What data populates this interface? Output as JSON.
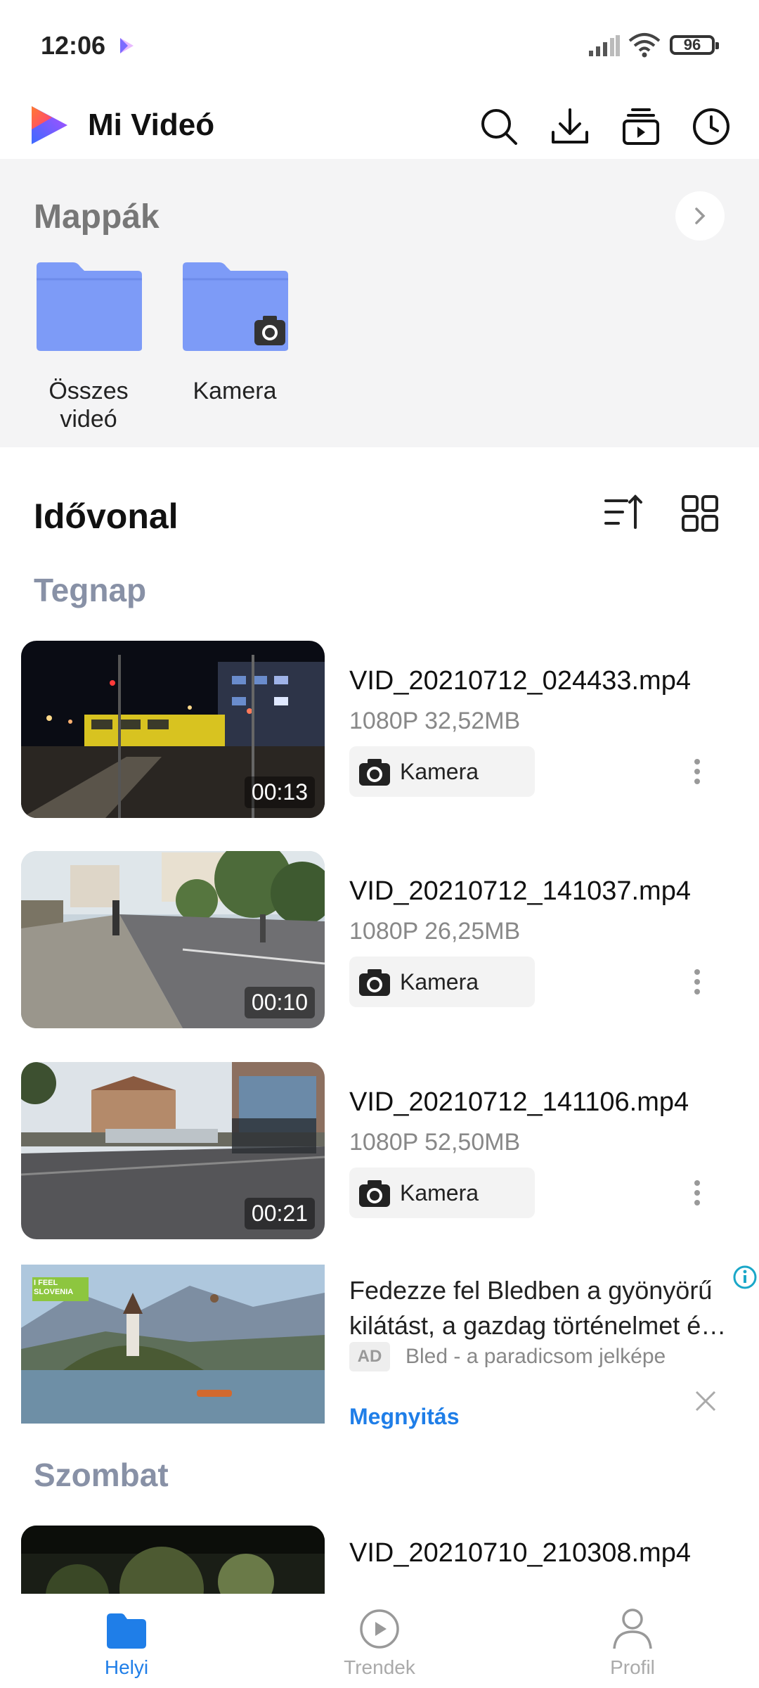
{
  "status_bar": {
    "time": "12:06",
    "battery": "96"
  },
  "app": {
    "title": "Mi Videó"
  },
  "folders": {
    "title": "Mappák",
    "items": [
      {
        "label_line1": "Összes",
        "label_line2": "videó"
      },
      {
        "label_line1": "Kamera",
        "label_line2": ""
      }
    ]
  },
  "timeline": {
    "title": "Idővonal"
  },
  "sections": {
    "yesterday": "Tegnap",
    "saturday": "Szombat"
  },
  "videos": [
    {
      "name": "VID_20210712_024433.mp4",
      "meta": "1080P  32,52MB",
      "source": "Kamera",
      "duration": "00:13"
    },
    {
      "name": "VID_20210712_141037.mp4",
      "meta": "1080P  26,25MB",
      "source": "Kamera",
      "duration": "00:10"
    },
    {
      "name": "VID_20210712_141106.mp4",
      "meta": "1080P  52,50MB",
      "source": "Kamera",
      "duration": "00:21"
    },
    {
      "name": "VID_20210710_210308.mp4"
    }
  ],
  "ad": {
    "line1": "Fedezze fel Bledben a gyönyörű",
    "line2": "kilátást, a gazdag történelmet és…",
    "tag": "AD",
    "source": "Bled - a paradicsom jelképe",
    "cta": "Megnyitás",
    "image_text": "I FEEL SLOVENIA"
  },
  "bottom_nav": [
    {
      "label": "Helyi",
      "active": true
    },
    {
      "label": "Trendek",
      "active": false
    },
    {
      "label": "Profil",
      "active": false
    }
  ],
  "colors": {
    "accent": "#1f7ee8",
    "folder": "#7d9bf7",
    "section_label": "#8891a6"
  },
  "icons": [
    "search-icon",
    "download-icon",
    "playlist-icon",
    "history-icon",
    "chevron-right-icon",
    "sort-icon",
    "grid-icon",
    "camera-icon",
    "more-vert-icon",
    "info-icon",
    "close-icon",
    "folder-icon",
    "play-circle-icon",
    "person-icon"
  ]
}
